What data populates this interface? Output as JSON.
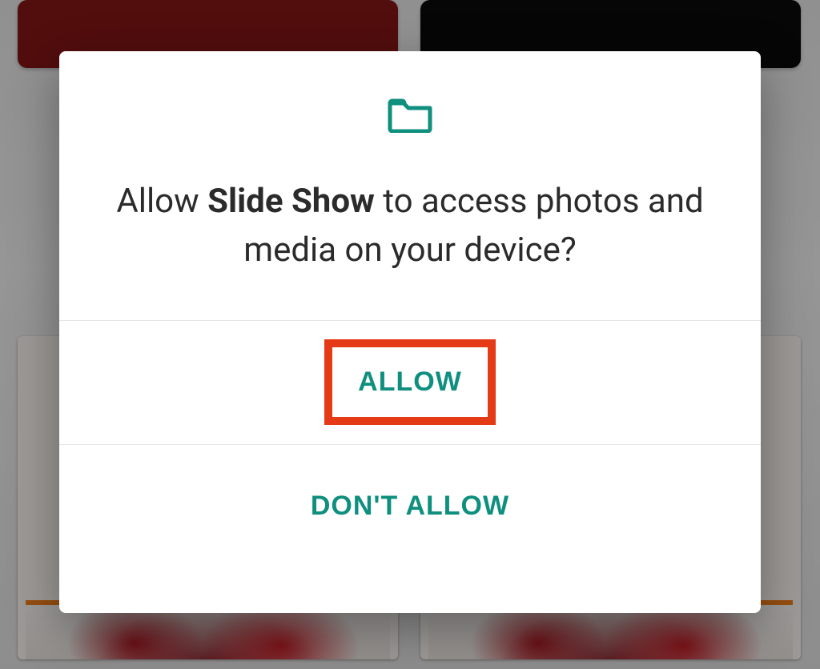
{
  "colors": {
    "accent": "#0f8f7e",
    "annotation": "#e53a16",
    "tile_left": "#7f1414",
    "tile_right": "#0a0a0a"
  },
  "dialog": {
    "icon": "folder-icon",
    "title_pre": "Allow ",
    "app_name": "Slide Show",
    "title_post": " to access photos and media on your device?",
    "allow_label": "ALLOW",
    "deny_label": "DON'T ALLOW"
  }
}
